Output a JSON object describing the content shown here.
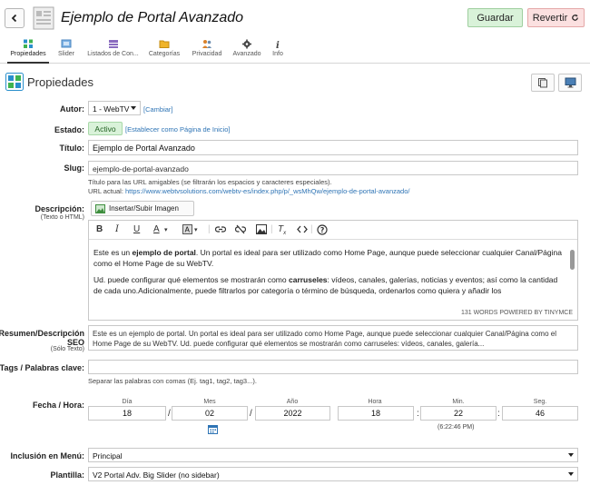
{
  "header": {
    "title": "Ejemplo de Portal Avanzado",
    "save_label": "Guardar",
    "revert_label": "Revertir"
  },
  "tabs": [
    {
      "label": "Propiedades",
      "icon": "grid-icon",
      "active": true
    },
    {
      "label": "Slider",
      "icon": "slides-icon"
    },
    {
      "label": "Listados de Con...",
      "icon": "list-icon"
    },
    {
      "label": "Categorías",
      "icon": "folder-icon"
    },
    {
      "label": "Privacidad",
      "icon": "users-icon"
    },
    {
      "label": "Avanzado",
      "icon": "gear-icon"
    },
    {
      "label": "Info",
      "icon": "info-icon"
    }
  ],
  "section": {
    "title": "Propiedades"
  },
  "form": {
    "autor_label": "Autor:",
    "autor_value": "1 - WebTV",
    "autor_link": "[Cambiar]",
    "estado_label": "Estado:",
    "estado_value": "Activo",
    "estado_link": "[Establecer como Página de Inicio]",
    "titulo_label": "Título:",
    "titulo_value": "Ejemplo de Portal Avanzado",
    "slug_label": "Slug:",
    "slug_value": "ejemplo-de-portal-avanzado",
    "slug_hint": "Título para las URL amigables (se filtrarán los espacios y caracteres especiales).",
    "url_label": "URL actual:",
    "url_value": "https://www.webtvsolutions.com/webtv-es/index.php/p/_wsMhQw/ejemplo-de-portal-avanzado/",
    "desc_label": "Descripción:",
    "desc_sub": "(Texto o HTML)",
    "insert_image": "Insertar/Subir Imagen",
    "desc_p1_a": "Este es un ",
    "desc_p1_b": "ejemplo de portal",
    "desc_p1_c": ". Un portal es ideal para ser utilizado como Home Page, aunque puede seleccionar cualquier Canal/Página como el Home Page de su WebTV.",
    "desc_p2_a": "Ud. puede configurar qué elementos se mostrarán como ",
    "desc_p2_b": "carruseles",
    "desc_p2_c": ": vídeos, canales, galerías, noticias y eventos; así como la cantidad de cada uno.Adicionalmente, puede filtrarlos por categoría o término de búsqueda, ordenarlos como quiera y añadir los",
    "editor_status": "131 WORDS POWERED BY TINYMCE",
    "summary_label": "Resumen/Descripción SEO",
    "summary_sub": "(Sólo Texto)",
    "summary_value": "Este es un ejemplo de portal. Un portal es ideal para ser utilizado como Home Page, aunque puede seleccionar cualquier Canal/Página como el Home Page de su WebTV. Ud. puede configurar qué elementos se mostrarán como carruseles: vídeos, canales, galería...",
    "tags_label": "Tags / Palabras clave:",
    "tags_hint": "Separar las palabras con comas (Ej. tag1, tag2, tag3...).",
    "fecha_label": "Fecha / Hora:",
    "fecha": {
      "dia_label": "Día",
      "dia": "18",
      "mes_label": "Mes",
      "mes": "02",
      "anio_label": "Año",
      "anio": "2022",
      "hora_label": "Hora",
      "hora": "18",
      "min_label": "Min.",
      "min": "22",
      "seg_label": "Seg.",
      "seg": "46",
      "time_display": "(6:22:46 PM)"
    },
    "menu_label": "Inclusión en Menú:",
    "menu_value": "Principal",
    "plantilla_label": "Plantilla:",
    "plantilla_value": "V2 Portal Adv. Big Slider (no sidebar)"
  },
  "colors": {
    "accent": "#2e74b5",
    "save_bg": "#d9f2d9",
    "revert_bg": "#fbe0e0"
  }
}
